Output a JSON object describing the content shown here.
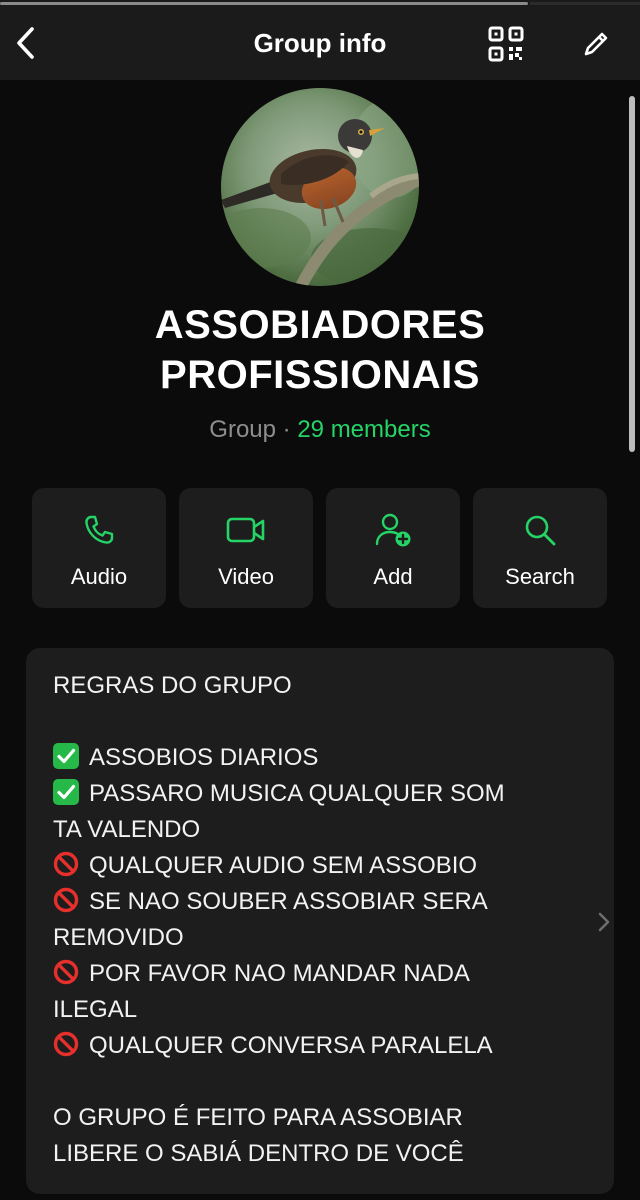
{
  "header": {
    "title": "Group info",
    "back_icon": "chevron-left-icon",
    "qr_icon": "qr-code-icon",
    "edit_icon": "pencil-icon"
  },
  "media_progress": {
    "fraction": 0.825
  },
  "group": {
    "name_line1": "ASSOBIADORES",
    "name_line2": "PROFISSIONAIS",
    "type": "Group",
    "separator": "·",
    "members": "29 members"
  },
  "actions": [
    {
      "label": "Audio",
      "icon": "phone-icon"
    },
    {
      "label": "Video",
      "icon": "video-camera-icon"
    },
    {
      "label": "Add",
      "icon": "add-person-icon"
    },
    {
      "label": "Search",
      "icon": "search-icon"
    }
  ],
  "description": {
    "heading": "REGRAS DO GRUPO",
    "rules": [
      {
        "emoji": "check",
        "line1": "ASSOBIOS DIARIOS"
      },
      {
        "emoji": "check",
        "line1": "PASSARO MUSICA QUALQUER SOM",
        "line2": "TA VALENDO"
      },
      {
        "emoji": "prohibited",
        "line1": "QUALQUER AUDIO SEM ASSOBIO"
      },
      {
        "emoji": "prohibited",
        "line1": "SE NAO SOUBER ASSOBIAR SERA",
        "line2": "REMOVIDO"
      },
      {
        "emoji": "prohibited",
        "line1": "POR FAVOR NAO MANDAR NADA",
        "line2": "ILEGAL"
      },
      {
        "emoji": "prohibited",
        "line1": "QUALQUER CONVERSA PARALELA"
      }
    ],
    "footer1": "O GRUPO É FEITO PARA ASSOBIAR",
    "footer2": "LIBERE O SABIÁ DENTRO DE VOCÊ"
  },
  "colors": {
    "accent": "#25d366",
    "background": "#0b0b0b",
    "card": "#1d1d1d",
    "header": "#1b1b1b"
  }
}
